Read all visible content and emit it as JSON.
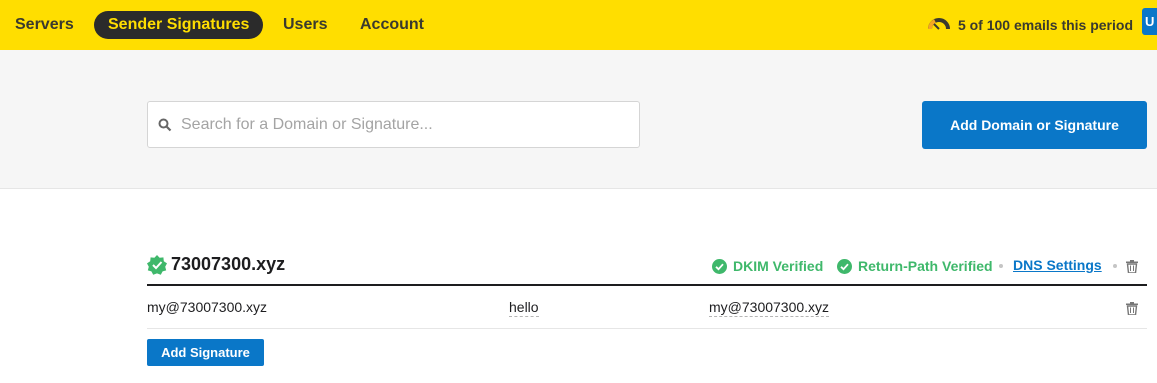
{
  "nav": {
    "items": [
      {
        "label": "Servers"
      },
      {
        "label": "Sender Signatures"
      },
      {
        "label": "Users"
      },
      {
        "label": "Account"
      }
    ],
    "usage_text": "5 of 100 emails this period",
    "edge_button_label": "U"
  },
  "toolbar": {
    "search_placeholder": "Search for a Domain or Signature...",
    "add_button_label": "Add Domain or Signature"
  },
  "domain": {
    "name": "73007300.xyz",
    "dkim_status": "DKIM Verified",
    "return_path_status": "Return-Path Verified",
    "dns_link": "DNS Settings"
  },
  "signatures": [
    {
      "from_email": "my@73007300.xyz",
      "name": "hello",
      "reply_to": "my@73007300.xyz"
    }
  ],
  "add_signature_label": "Add Signature",
  "colors": {
    "brand_yellow": "#ffde00",
    "accent_blue": "#0a77c8",
    "verified_green": "#3fb86b",
    "dark": "#2b2b2b"
  },
  "icons": [
    "search-icon",
    "gauge-icon",
    "verified-badge-icon",
    "check-circle-icon",
    "trash-icon"
  ]
}
